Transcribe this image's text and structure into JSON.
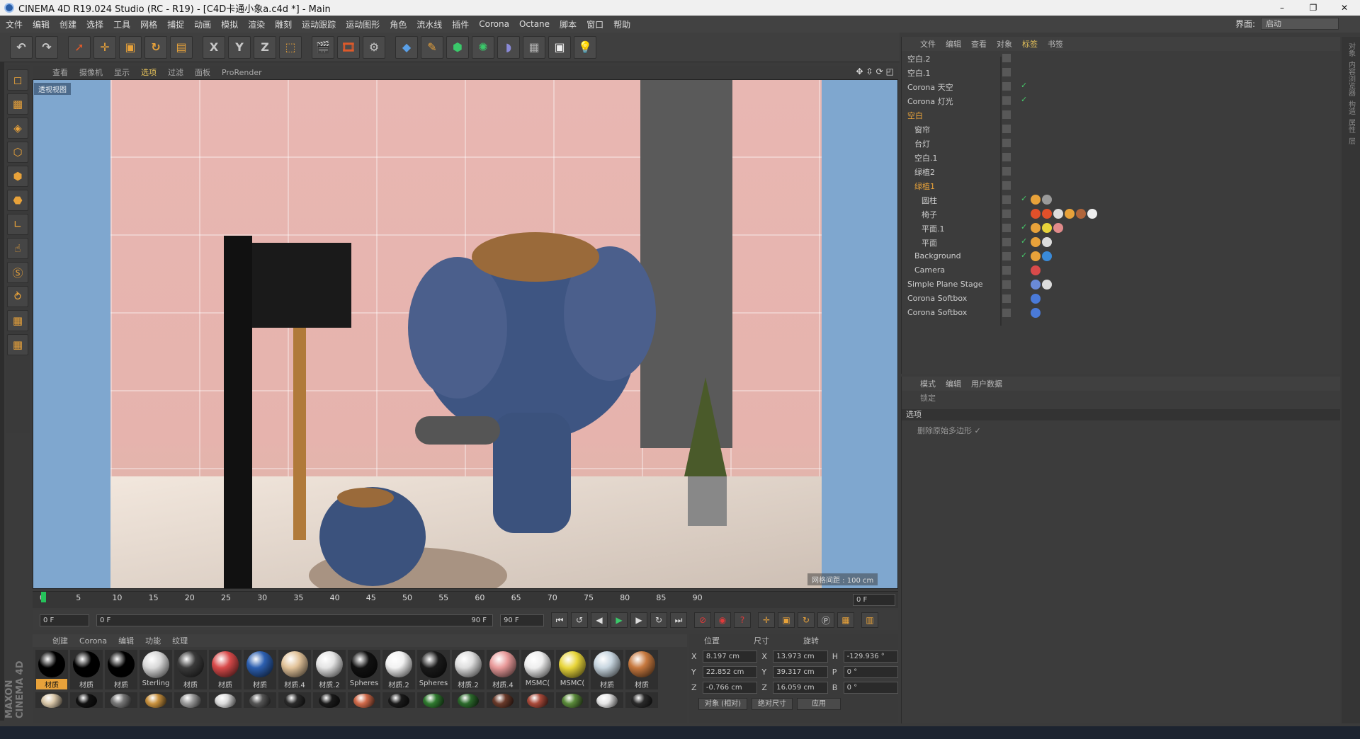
{
  "window": {
    "title": "CINEMA 4D R19.024 Studio (RC - R19) - [C4D卡通小象a.c4d *] - Main",
    "controls": [
      "–",
      "❐",
      "✕"
    ]
  },
  "menubar": {
    "items": [
      "文件",
      "编辑",
      "创建",
      "选择",
      "工具",
      "网格",
      "捕捉",
      "动画",
      "模拟",
      "渲染",
      "雕刻",
      "运动跟踪",
      "运动图形",
      "角色",
      "流水线",
      "插件",
      "Corona",
      "Octane",
      "脚本",
      "窗口",
      "帮助"
    ],
    "layout_label": "界面:",
    "layout_value": "启动"
  },
  "toolbar": {
    "icons": [
      "undo-icon",
      "redo-icon",
      "select-icon",
      "move-icon",
      "scale-icon",
      "rotate-icon",
      "recent-icon",
      "x-axis-icon",
      "y-axis-icon",
      "z-axis-icon",
      "coord-icon",
      "render-view-icon",
      "render-picture-icon",
      "render-settings-icon",
      "cube-icon",
      "pen-icon",
      "subdivide-icon",
      "cloner-icon",
      "deformer-icon",
      "floor-icon",
      "camera-icon",
      "light-icon"
    ],
    "xyz": [
      "X",
      "Y",
      "Z"
    ]
  },
  "viewport": {
    "menu": [
      "查看",
      "摄像机",
      "显示",
      "选项",
      "过滤",
      "面板",
      "ProRender"
    ],
    "active_menu": "选项",
    "label": "透视视图",
    "grid_info": "网格间距 : 100 cm"
  },
  "timeline": {
    "ticks": [
      "0",
      "5",
      "10",
      "15",
      "20",
      "25",
      "30",
      "35",
      "40",
      "45",
      "50",
      "55",
      "60",
      "65",
      "70",
      "75",
      "80",
      "85",
      "90"
    ],
    "current_frame": "0 F",
    "start": "0 F",
    "range_start": "0 F",
    "range_end": "90 F",
    "end": "90 F"
  },
  "materials": {
    "tabs": [
      "创建",
      "Corona",
      "编辑",
      "功能",
      "纹理"
    ],
    "row1": [
      {
        "name": "材质",
        "color": "#000000",
        "selected": true
      },
      {
        "name": "材质",
        "color": "#000000"
      },
      {
        "name": "材质",
        "color": "#000000"
      },
      {
        "name": "Sterling",
        "color": "#d8d8d8"
      },
      {
        "name": "材质",
        "color": "#3a3a3a"
      },
      {
        "name": "材质",
        "color": "#d84a4a"
      },
      {
        "name": "材质",
        "color": "#2c5fb0"
      },
      {
        "name": "材质.4",
        "color": "#e2c39a"
      },
      {
        "name": "材质.2",
        "color": "#e4e4e4"
      },
      {
        "name": "Spheres",
        "color": "#111111"
      },
      {
        "name": "材质.2",
        "color": "#f2f2f2"
      },
      {
        "name": "Spheres",
        "color": "#1a1a1a"
      },
      {
        "name": "材质.2",
        "color": "#dedede"
      },
      {
        "name": "材质.4",
        "color": "#e99a9a"
      },
      {
        "name": "MSMC(",
        "color": "#eeeeee"
      },
      {
        "name": "MSMC(",
        "color": "#e8d53a"
      },
      {
        "name": "材质",
        "color": "#c8d6e0"
      },
      {
        "name": "材质",
        "color": "#c7793f"
      }
    ],
    "row2": [
      "#d9c7a9",
      "#111111",
      "#777777",
      "#c9923f",
      "#9a9a9a",
      "#dcdcdc",
      "#555555",
      "#2a2a2a",
      "#1a1a1a",
      "#d06a4a",
      "#1a1a1a",
      "#2f7a2f",
      "#2c6a2c",
      "#6a3a2a",
      "#aa4a3a",
      "#5a8a3a",
      "#e6e6e6",
      "#2a2a2a"
    ]
  },
  "coords": {
    "headers": [
      "位置",
      "尺寸",
      "旋转"
    ],
    "rows": [
      {
        "a": "X",
        "v1": "8.197 cm",
        "b": "X",
        "v2": "13.973 cm",
        "c": "H",
        "v3": "-129.936 °"
      },
      {
        "a": "Y",
        "v1": "22.852 cm",
        "b": "Y",
        "v2": "39.317 cm",
        "c": "P",
        "v3": "0 °"
      },
      {
        "a": "Z",
        "v1": "-0.766 cm",
        "b": "Z",
        "v2": "16.059 cm",
        "c": "B",
        "v3": "0 °"
      }
    ],
    "mode": "对象 (相对)",
    "size_mode": "绝对尺寸",
    "apply": "应用"
  },
  "objmgr": {
    "menu": [
      "文件",
      "编辑",
      "查看",
      "对象",
      "标签",
      "书签"
    ],
    "active_menu": "标签",
    "items": [
      {
        "name": "空白.2",
        "indent": 0,
        "hl": false,
        "check": false,
        "tags": []
      },
      {
        "name": "空白.1",
        "indent": 0,
        "hl": false,
        "check": false,
        "tags": []
      },
      {
        "name": "Corona 天空",
        "indent": 0,
        "hl": false,
        "check": true,
        "tags": []
      },
      {
        "name": "Corona 灯光",
        "indent": 0,
        "hl": false,
        "check": true,
        "tags": []
      },
      {
        "name": "空白",
        "indent": 0,
        "hl": true,
        "check": false,
        "tags": []
      },
      {
        "name": "窗帘",
        "indent": 1,
        "hl": false,
        "check": false,
        "tags": []
      },
      {
        "name": "台灯",
        "indent": 1,
        "hl": false,
        "check": false,
        "tags": []
      },
      {
        "name": "空白.1",
        "indent": 1,
        "hl": false,
        "check": false,
        "tags": []
      },
      {
        "name": "绿植2",
        "indent": 1,
        "hl": false,
        "check": false,
        "tags": []
      },
      {
        "name": "绿植1",
        "indent": 1,
        "hl": true,
        "check": false,
        "tags": []
      },
      {
        "name": "圆柱",
        "indent": 2,
        "hl": false,
        "check": true,
        "tags": [
          "#e8a23a",
          "#9a9a9a"
        ]
      },
      {
        "name": "椅子",
        "indent": 2,
        "hl": false,
        "check": false,
        "tags": [
          "#e0502a",
          "#e0502a",
          "#dddddd",
          "#e8a23a",
          "#b0653a",
          "#eeeeee"
        ]
      },
      {
        "name": "平面.1",
        "indent": 2,
        "hl": false,
        "check": true,
        "tags": [
          "#e8a23a",
          "#e6d23a",
          "#e08a8a"
        ]
      },
      {
        "name": "平面",
        "indent": 2,
        "hl": false,
        "check": true,
        "tags": [
          "#e8a23a",
          "#dcdcdc"
        ]
      },
      {
        "name": "Background",
        "indent": 1,
        "hl": false,
        "check": true,
        "tags": [
          "#e8a23a",
          "#3a8ad8"
        ]
      },
      {
        "name": "Camera",
        "indent": 1,
        "hl": false,
        "check": false,
        "tags": [
          "#d84a4a"
        ]
      },
      {
        "name": "Simple Plane Stage",
        "indent": 0,
        "hl": false,
        "check": false,
        "tags": [
          "#6a8ad8",
          "#dcdcdc"
        ]
      },
      {
        "name": "Corona Softbox",
        "indent": 0,
        "hl": false,
        "check": false,
        "tags": [
          "#4a7ad8"
        ]
      },
      {
        "name": "Corona Softbox",
        "indent": 0,
        "hl": false,
        "check": false,
        "tags": [
          "#4a7ad8"
        ]
      }
    ]
  },
  "attrmgr": {
    "menu": [
      "模式",
      "编辑",
      "用户数据"
    ],
    "sub": "锁定",
    "section": "选项",
    "option": "删除原始多边形 ✓"
  },
  "rightstrip": [
    "对象",
    "内容浏览器",
    "构造",
    "属性",
    "层"
  ],
  "maxon": "MAXON CINEMA 4D"
}
